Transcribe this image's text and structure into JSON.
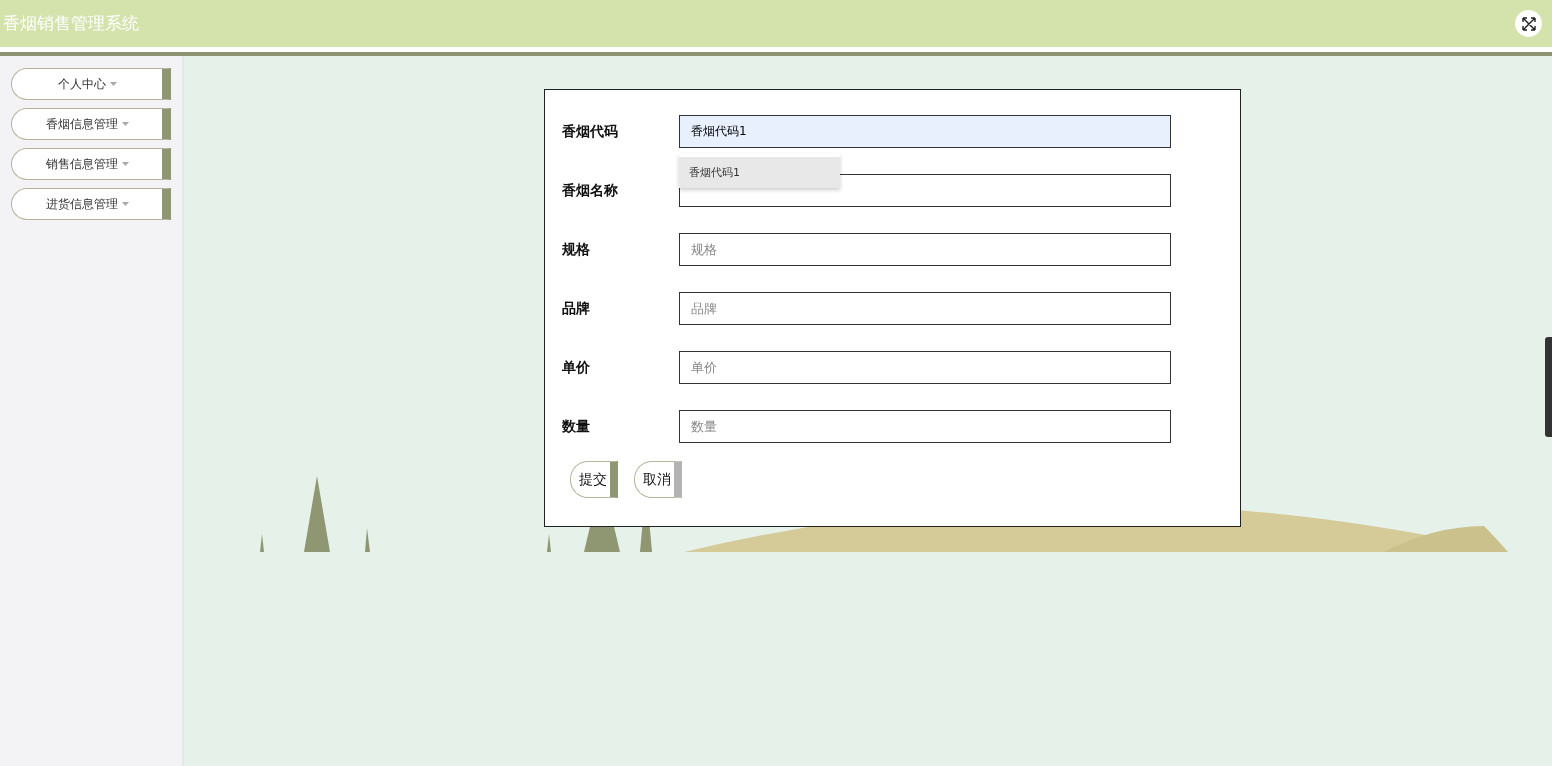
{
  "header": {
    "title": "香烟销售管理系统"
  },
  "sidebar": {
    "items": [
      {
        "label": "个人中心"
      },
      {
        "label": "香烟信息管理"
      },
      {
        "label": "销售信息管理"
      },
      {
        "label": "进货信息管理"
      }
    ]
  },
  "form": {
    "fields": [
      {
        "label": "香烟代码",
        "value": "香烟代码1",
        "focused": true,
        "suggestions": [
          "香烟代码1"
        ]
      },
      {
        "label": "香烟名称",
        "focused": false
      },
      {
        "label": "规格",
        "placeholder": "规格",
        "focused": false
      },
      {
        "label": "品牌",
        "placeholder": "品牌",
        "focused": false
      },
      {
        "label": "单价",
        "placeholder": "单价",
        "focused": false
      },
      {
        "label": "数量",
        "placeholder": "数量",
        "focused": false
      }
    ],
    "buttons": [
      {
        "label": "提交",
        "kind": "primary"
      },
      {
        "label": "取消",
        "kind": "secondary"
      }
    ]
  }
}
